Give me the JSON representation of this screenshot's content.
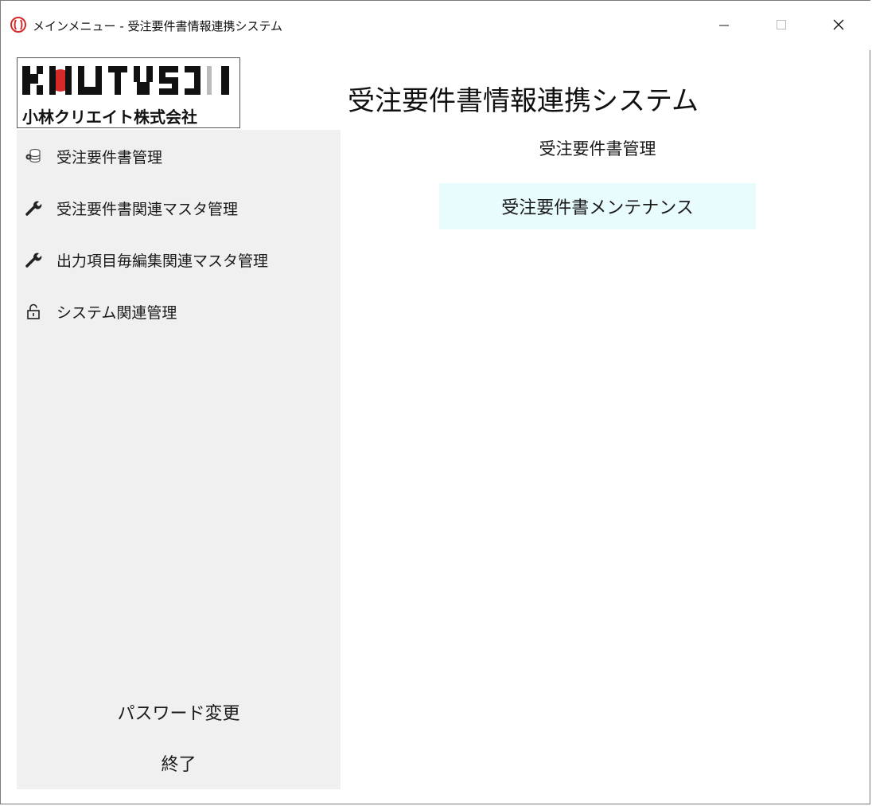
{
  "window": {
    "title": "メインメニュー - 受注要件書情報連携システム",
    "buttons": {
      "minimize": "minimize-icon",
      "maximize": "maximize-icon",
      "close": "close-icon"
    }
  },
  "logo": {
    "company": "小林クリエイト株式会社",
    "brand_mark": "KOBAYASHI"
  },
  "sidebar": {
    "items": [
      {
        "label": "受注要件書管理",
        "icon": "database-icon"
      },
      {
        "label": "受注要件書関連マスタ管理",
        "icon": "wrench-icon"
      },
      {
        "label": "出力項目毎編集関連マスタ管理",
        "icon": "wrench-icon"
      },
      {
        "label": "システム関連管理",
        "icon": "lock-icon"
      }
    ],
    "password_change": "パスワード変更",
    "exit": "終了"
  },
  "main": {
    "app_title": "受注要件書情報連携システム",
    "section_title": "受注要件書管理",
    "action_button": "受注要件書メンテナンス"
  },
  "colors": {
    "sidebar_bg": "#f0f0f0",
    "action_bg": "#e8fbfd",
    "logo_red": "#d42a2a"
  }
}
